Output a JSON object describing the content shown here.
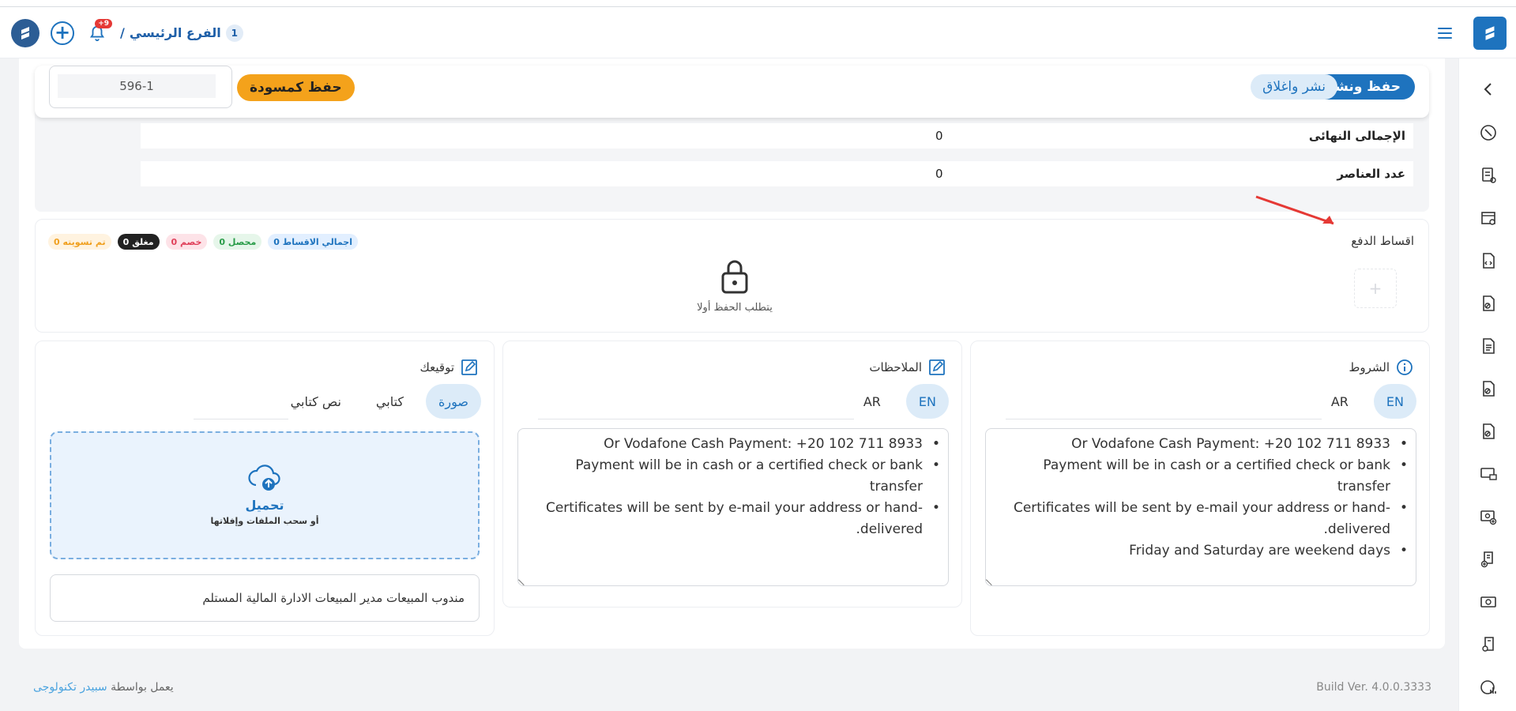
{
  "header": {
    "branch_num": "1",
    "branch_name": "الفرع الرئيسي",
    "branch_sep": "/",
    "notif_badge": "+9"
  },
  "actions": {
    "save_publish": "حفظ ونشر",
    "publish_close": "نشر واغلاق",
    "save_draft": "حفظ كمسودة",
    "doc_number": "596-1"
  },
  "totals": {
    "rows": [
      {
        "label": "الإجمالى النهائى",
        "value": "0"
      },
      {
        "label": "عدد العناصر",
        "value": "0"
      }
    ]
  },
  "installments": {
    "title": "اقساط الدفع",
    "pills": {
      "total": "اجمالي الاقساط 0",
      "collected": "محصل 0",
      "discount": "خصم 0",
      "closed": "مغلق 0",
      "settled": "تم تسويته 0"
    },
    "locked_text": "يتطلب الحفظ أولا"
  },
  "terms": {
    "title": "الشروط",
    "tab_en": "EN",
    "tab_ar": "AR",
    "lines": [
      "",
      "Or Vodafone Cash Payment: +20 102 711 8933",
      "Payment will be in cash or a certified check or bank transfer",
      "Certificates will be sent by e-mail your address or hand-delivered.",
      "Friday and Saturday are weekend days"
    ]
  },
  "notes": {
    "title": "الملاحظات",
    "tab_en": "EN",
    "tab_ar": "AR",
    "lines": [
      "",
      "Or Vodafone Cash Payment: +20 102 711 8933",
      "Payment will be in cash or a certified check or bank transfer",
      "Certificates will be sent by e-mail your address or hand-delivered."
    ]
  },
  "signature": {
    "title": "توقيعك",
    "tab_image": "صورة",
    "tab_written": "كتابي",
    "tab_text": "نص كتابي",
    "upload_title": "تحميل",
    "upload_sub": "أو سحب الملفات وإفلاتها",
    "names": "مندوب المبيعات مدير المبيعات الادارة المالية المستلم"
  },
  "footer": {
    "powered_prefix": "يعمل بواسطة",
    "powered_link": "سبيدر تكنولوجى",
    "build": "Build Ver. 4.0.0.3333"
  },
  "colors": {
    "primary": "#1e73be",
    "draft": "#f4a21b",
    "annotation_arrow": "#e53935"
  },
  "icons": {
    "menu": "hamburger-icon",
    "brand": "logo-icon",
    "notifications": "bell-icon",
    "add": "plus-icon",
    "lock": "lock-icon",
    "upload": "cloud-upload-icon",
    "info": "info-icon",
    "edit": "edit-icon"
  }
}
